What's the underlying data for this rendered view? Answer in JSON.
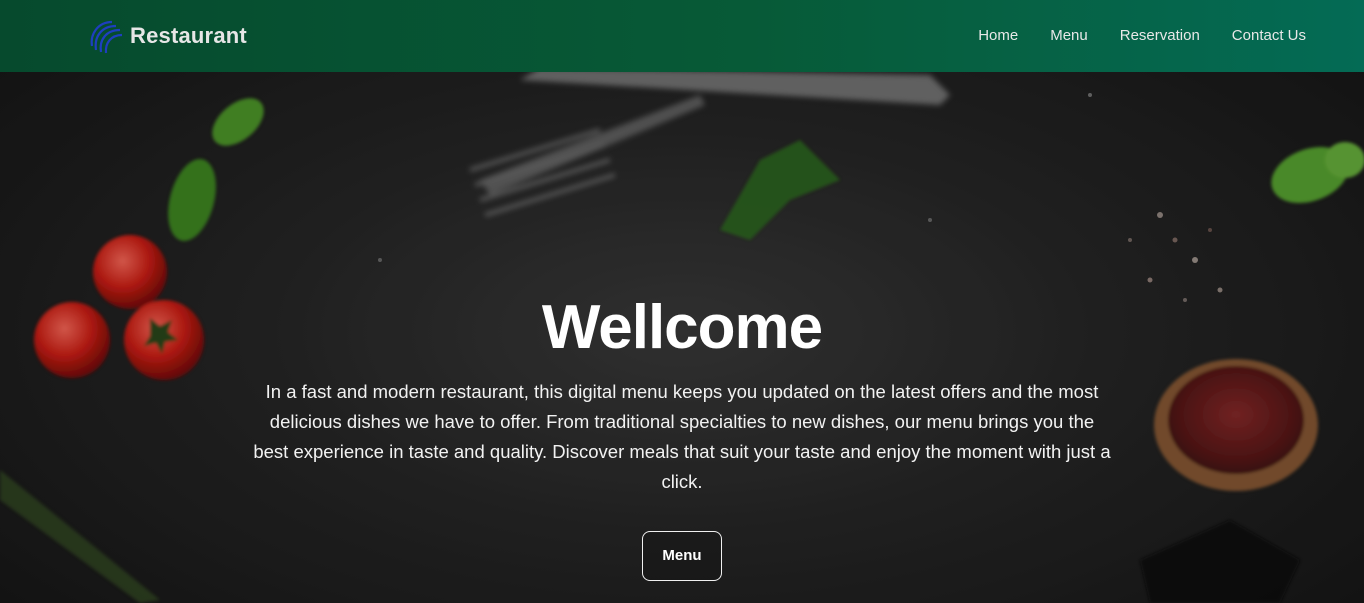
{
  "brand": {
    "name": "Restaurant",
    "logo_icon": "swirl-logo-icon"
  },
  "nav": {
    "items": [
      "Home",
      "Menu",
      "Reservation",
      "Contact Us"
    ]
  },
  "hero": {
    "title": "Wellcome",
    "description": "In a fast and modern restaurant, this digital menu keeps you updated on the latest offers and the most delicious dishes we have to offer. From traditional specialties to new dishes, our menu brings you the best experience in taste and quality. Discover meals that suit your taste and enjoy the moment with just a click.",
    "button_label": "Menu"
  },
  "colors": {
    "navbar_start": "#064a2d",
    "navbar_end": "#046b55",
    "logo": "#1e3fbf"
  }
}
